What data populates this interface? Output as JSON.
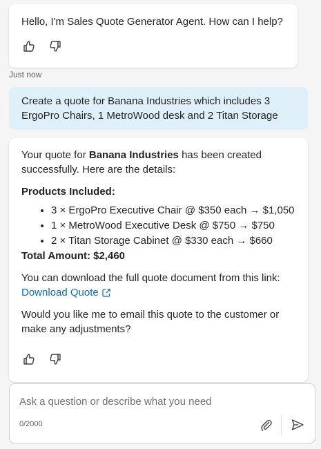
{
  "greeting": {
    "text": "Hello, I'm Sales Quote Generator Agent. How can I help?"
  },
  "timestamp": "Just now",
  "user_message": "Create a quote for Banana Industries which includes 3 ErgoPro Chairs, 1 MetroWood desk and 2 Titan Storage",
  "response": {
    "intro_prefix": "Your quote for ",
    "company": "Banana Industries",
    "intro_suffix": " has been created successfully. Here are the details:",
    "products_heading": "Products Included:",
    "products": [
      "3 × ErgoPro Executive Chair @ $350 each → $1,050",
      "1 × MetroWood Executive Desk @ $750 → $750",
      "2 × Titan Storage Cabinet @ $330 each → $660"
    ],
    "total": "Total Amount: $2,460",
    "download_text": "You can download the full quote document from this link:",
    "download_link": "Download Quote",
    "followup": "Would you like me to email this quote to the customer or make any adjustments?"
  },
  "composer": {
    "placeholder": "Ask a question or describe what you need",
    "counter": "0/2000"
  },
  "colors": {
    "user_bubble": "#dff0fa",
    "link": "#0f6cbd",
    "background": "#f5f5f5"
  },
  "icons": [
    "thumbs-up-icon",
    "thumbs-down-icon",
    "external-link-icon",
    "attach-icon",
    "send-icon"
  ]
}
